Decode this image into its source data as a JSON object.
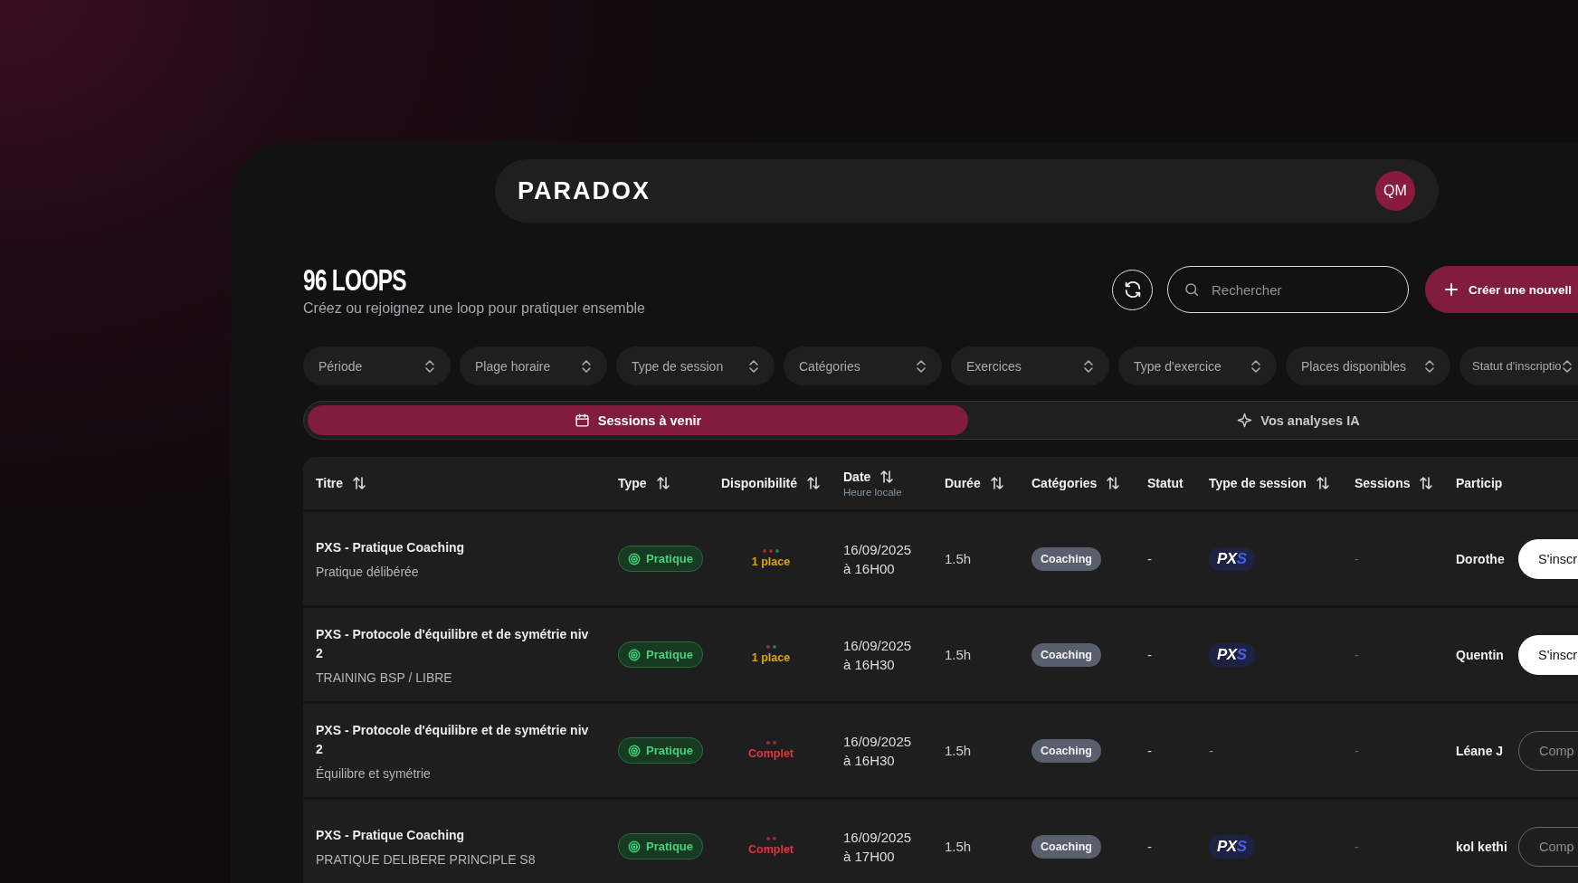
{
  "header": {
    "logo": "PARADOX",
    "avatar": "QM"
  },
  "page": {
    "title": "96 LOOPS",
    "subtitle": "Créez ou rejoignez une loop pour pratiquer ensemble"
  },
  "search": {
    "placeholder": "Rechercher"
  },
  "create_button": "Créer une nouvell",
  "filters": [
    "Période",
    "Plage horaire",
    "Type de session",
    "Catégories",
    "Exercices",
    "Type d'exercice",
    "Places disponibles",
    "Statut d'inscriptio"
  ],
  "tabs": [
    {
      "label": "Sessions à venir",
      "selected": true
    },
    {
      "label": "Vos analyses IA",
      "selected": false
    }
  ],
  "table": {
    "columns": [
      {
        "label": "Titre",
        "sortable": true
      },
      {
        "label": "Type",
        "sortable": true
      },
      {
        "label": "Disponibilité",
        "sortable": true
      },
      {
        "label": "Date",
        "sortable": true,
        "sublabel": "Heure locale"
      },
      {
        "label": "Durée",
        "sortable": true
      },
      {
        "label": "Catégories",
        "sortable": true
      },
      {
        "label": "Statut",
        "sortable": false
      },
      {
        "label": "Type de session",
        "sortable": true
      },
      {
        "label": "Sessions",
        "sortable": true
      },
      {
        "label": "Particip",
        "sortable": false
      }
    ],
    "rows": [
      {
        "title": "PXS - Pratique Coaching",
        "subtitle": "Pratique délibérée",
        "type": "Pratique",
        "dots": [
          {
            "color": "#9b2c36"
          },
          {
            "color": "#9b2c36"
          },
          {
            "color": "#1f7a5a"
          }
        ],
        "availability": {
          "kind": "limited",
          "text": "1 place"
        },
        "date": "16/09/2025",
        "time": "à 16H00",
        "duration": "1.5h",
        "category": "Coaching",
        "status": "-",
        "session_type": {
          "kind": "logo",
          "main": "PX",
          "accent": "S"
        },
        "sessions": "-",
        "participant": "Dorothe",
        "action": {
          "kind": "register",
          "label": "S'inscr"
        }
      },
      {
        "title": "PXS - Protocole d'équilibre et de symétrie niv 2",
        "subtitle": "TRAINING BSP / LIBRE",
        "type": "Pratique",
        "dots": [
          {
            "color": "#9b2c36"
          },
          {
            "color": "#1f7a5a"
          }
        ],
        "availability": {
          "kind": "limited",
          "text": "1 place"
        },
        "date": "16/09/2025",
        "time": "à 16H30",
        "duration": "1.5h",
        "category": "Coaching",
        "status": "-",
        "session_type": {
          "kind": "logo",
          "main": "PX",
          "accent": "S"
        },
        "sessions": "-",
        "participant": "Quentin",
        "action": {
          "kind": "register",
          "label": "S'inscr"
        }
      },
      {
        "title": "PXS - Protocole d'équilibre et de symétrie niv 2",
        "subtitle": "Équilibre et symétrie",
        "type": "Pratique",
        "dots": [
          {
            "color": "#9b2c36"
          },
          {
            "color": "#9b2c36"
          }
        ],
        "availability": {
          "kind": "full",
          "text": "Complet"
        },
        "date": "16/09/2025",
        "time": "à 16H30",
        "duration": "1.5h",
        "category": "Coaching",
        "status": "-",
        "session_type": {
          "kind": "text",
          "text": "-"
        },
        "sessions": "-",
        "participant": "Léane J",
        "action": {
          "kind": "full",
          "label": "Comp"
        }
      },
      {
        "title": "PXS - Pratique Coaching",
        "subtitle": "PRATIQUE DELIBERE PRINCIPLE S8",
        "type": "Pratique",
        "dots": [
          {
            "color": "#9b2c36"
          },
          {
            "color": "#9b2c36"
          }
        ],
        "availability": {
          "kind": "full",
          "text": "Complet"
        },
        "date": "16/09/2025",
        "time": "à 17H00",
        "duration": "1.5h",
        "category": "Coaching",
        "status": "-",
        "session_type": {
          "kind": "logo",
          "main": "PX",
          "accent": "S"
        },
        "sessions": "-",
        "participant": "kol kethi",
        "action": {
          "kind": "full",
          "label": "Comp"
        }
      }
    ]
  }
}
